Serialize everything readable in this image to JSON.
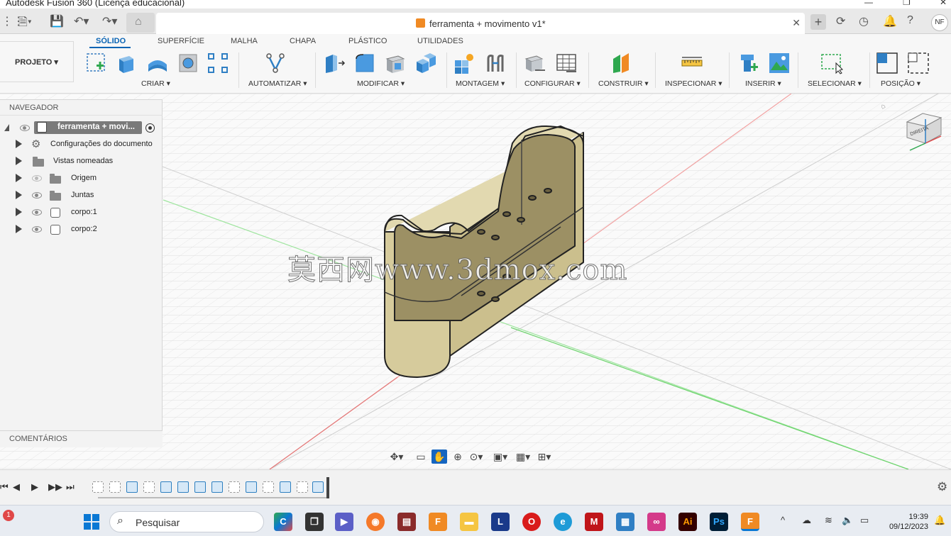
{
  "window": {
    "title": "Autodesk Fusion 360 (Licença educacional)"
  },
  "appbar": {
    "document_tab_label": "ferramenta + movimento v1*",
    "user_initials": "NF"
  },
  "toolbar": {
    "project_label": "PROJETO ▾",
    "tabs": [
      "SÓLIDO",
      "SUPERFÍCIE",
      "MALHA",
      "CHAPA",
      "PLÁSTICO",
      "UTILIDADES"
    ],
    "active_tab": "SÓLIDO",
    "groups": [
      "CRIAR ▾",
      "AUTOMATIZAR ▾",
      "MODIFICAR ▾",
      "MONTAGEM ▾",
      "CONFIGURAR ▾",
      "CONSTRUIR ▾",
      "INSPECIONAR ▾",
      "INSERIR ▾",
      "SELECIONAR ▾",
      "POSIÇÃO ▾"
    ]
  },
  "navigator": {
    "header": "NAVEGADOR",
    "root_label": "ferramenta + movi...",
    "items": [
      {
        "label": "Configurações do documento",
        "icon": "gear-icon"
      },
      {
        "label": "Vistas nomeadas",
        "icon": "folder-icon"
      },
      {
        "label": "Origem",
        "icon": "folder-icon"
      },
      {
        "label": "Juntas",
        "icon": "folder-icon"
      },
      {
        "label": "corpo:1",
        "icon": "body-icon"
      },
      {
        "label": "corpo:2",
        "icon": "body-icon"
      }
    ]
  },
  "comments": {
    "label": "COMENTÁRIOS"
  },
  "canvas": {
    "watermark": "莫西网www.3dmox.com",
    "model_color": "#d6cb9c",
    "viewcube_label": "DIREITA"
  },
  "taskbar": {
    "search_placeholder": "Pesquisar",
    "time": "19:39",
    "date": "09/12/2023",
    "notification_count": "1"
  }
}
